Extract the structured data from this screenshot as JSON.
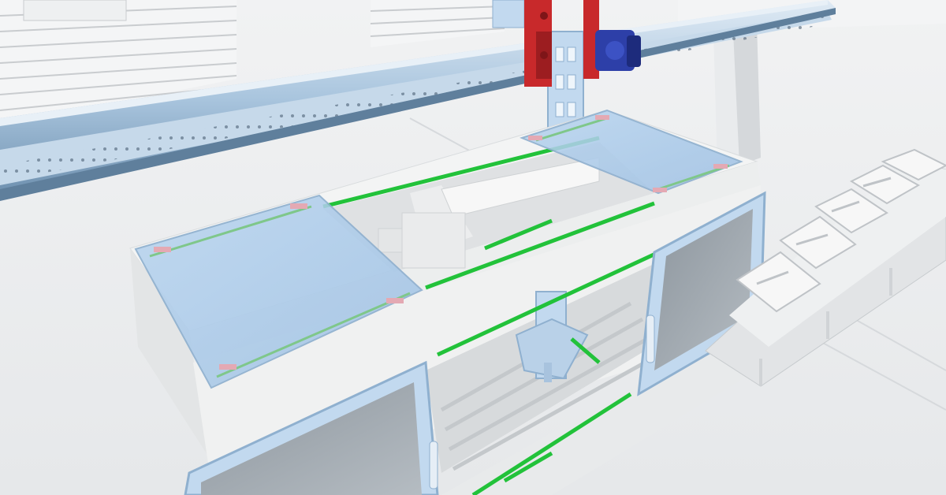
{
  "scene": {
    "description_free": true,
    "colors": {
      "background": "#eceeef",
      "wall": "#f4f5f6",
      "wall_lines": "#c9cccf",
      "gantry_rail": "#b9d0e4",
      "rail_dark": "#5f7f9c",
      "carriage_red": "#c8292b",
      "motor_blue": "#2d3fa8",
      "column_blue": "#c2d9ef",
      "cabinet_white": "#f3f4f4",
      "cabinet_shadow": "#d9dcde",
      "glass_blue": "#a9c8e6",
      "glass_frame": "#bcd5ee",
      "safety_green": "#22c23a",
      "conveyor_grey": "#e2e4e6",
      "tray_white": "#f7f7f7",
      "tray_holes": "#bfc3c7",
      "interior_grey": "#dfe1e3"
    }
  }
}
